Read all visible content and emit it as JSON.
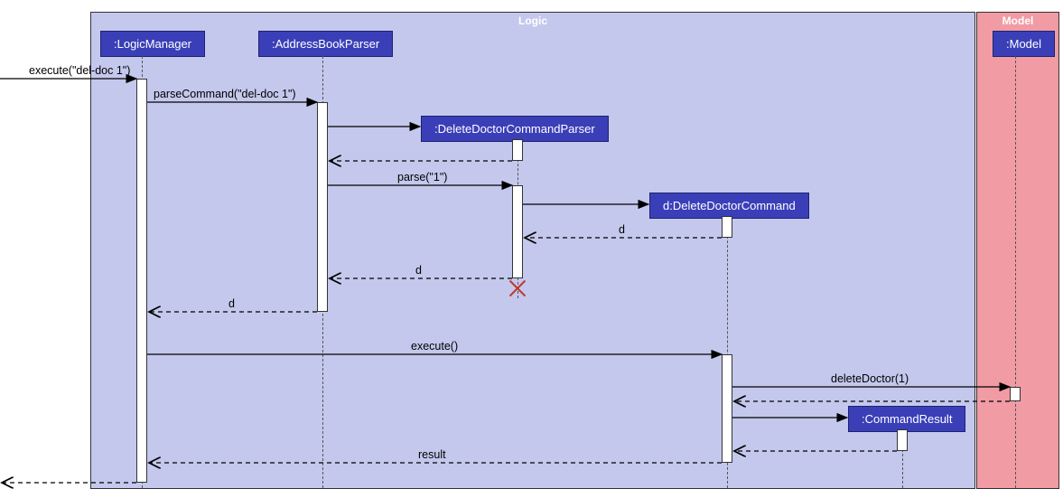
{
  "frames": {
    "logic": "Logic",
    "model": "Model"
  },
  "participants": {
    "logicManager": ":LogicManager",
    "addressBookParser": ":AddressBookParser",
    "deleteDoctorCommandParser": ":DeleteDoctorCommandParser",
    "deleteDoctorCommand": "d:DeleteDoctorCommand",
    "commandResult": ":CommandResult",
    "model": ":Model"
  },
  "messages": {
    "execute_deldoc": "execute(\"del-doc 1\")",
    "parseCommand": "parseCommand(\"del-doc 1\")",
    "parse": "parse(\"1\")",
    "d1": "d",
    "d2": "d",
    "d3": "d",
    "execute": "execute()",
    "deleteDoctor": "deleteDoctor(1)",
    "result": "result"
  }
}
